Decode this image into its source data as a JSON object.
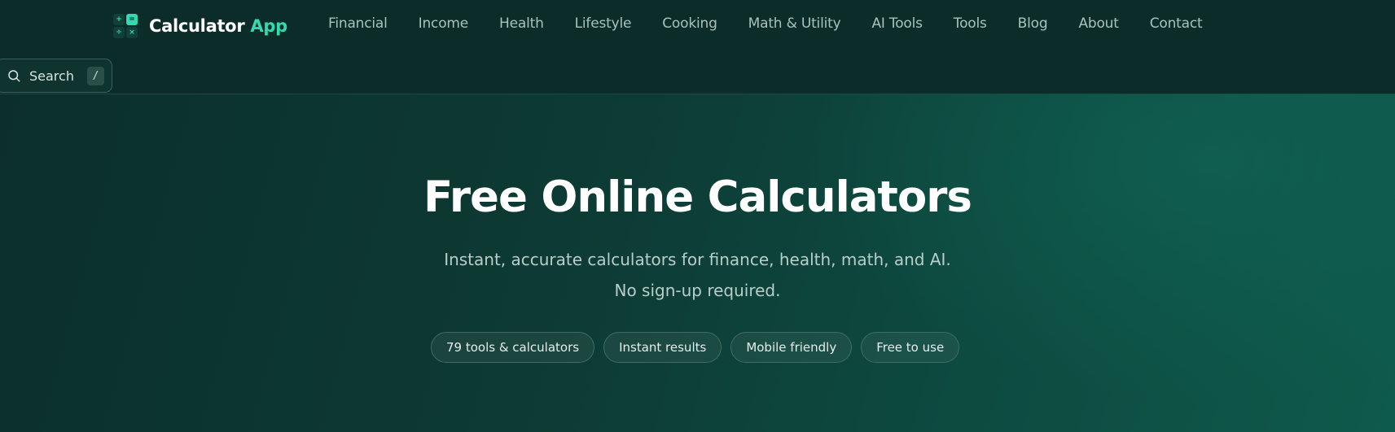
{
  "brand": {
    "name": "Calculator",
    "accent": "App",
    "logo_symbols": [
      "+",
      "=",
      "÷",
      "×"
    ],
    "accent_color": "#35d9b0"
  },
  "nav": {
    "items": [
      {
        "label": "Financial"
      },
      {
        "label": "Income"
      },
      {
        "label": "Health"
      },
      {
        "label": "Lifestyle"
      },
      {
        "label": "Cooking"
      },
      {
        "label": "Math & Utility"
      },
      {
        "label": "AI Tools"
      },
      {
        "label": "Tools"
      },
      {
        "label": "Blog"
      },
      {
        "label": "About"
      },
      {
        "label": "Contact"
      }
    ]
  },
  "search": {
    "label": "Search",
    "shortcut": "/",
    "icon": "search-icon"
  },
  "hero": {
    "title": "Free Online Calculators",
    "subtitle_line1": "Instant, accurate calculators for finance, health, math, and AI.",
    "subtitle_line2": "No sign-up required.",
    "badges": [
      {
        "label": "79 tools & calculators"
      },
      {
        "label": "Instant results"
      },
      {
        "label": "Mobile friendly"
      },
      {
        "label": "Free to use"
      }
    ]
  }
}
